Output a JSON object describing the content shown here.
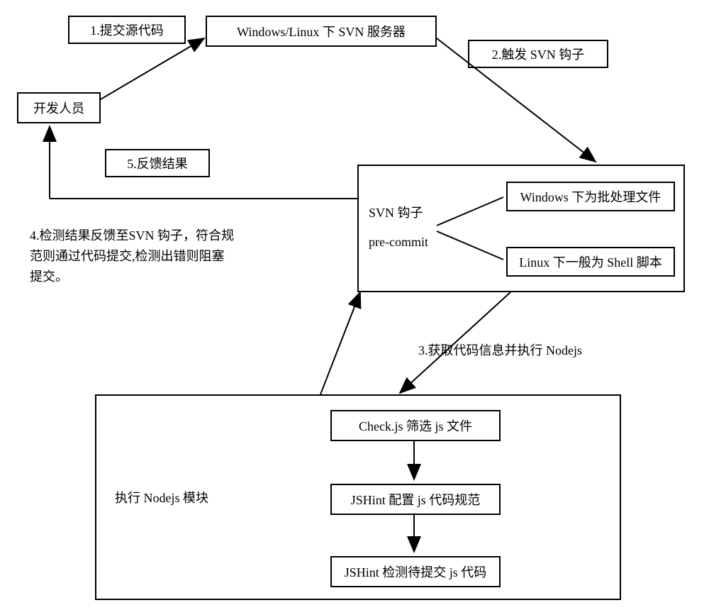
{
  "nodes": {
    "developer": "开发人员",
    "svn_server": "Windows/Linux 下 SVN 服务器",
    "svn_hook_title1": "SVN 钩子",
    "svn_hook_title2": "pre-commit",
    "hook_windows": "Windows 下为批处理文件",
    "hook_linux": "Linux 下一般为 Shell 脚本",
    "nodejs_title": "执行 Nodejs 模块",
    "check_js": "Check.js 筛选 js 文件",
    "jshint_config": "JSHint 配置 js 代码规范",
    "jshint_check": "JSHint 检测待提交 js 代码"
  },
  "edges": {
    "step1": "1.提交源代码",
    "step2": "2.触发 SVN 钩子",
    "step3": "3.获取代码信息并执行 Nodejs",
    "step4": "4.检测结果反馈至SVN 钩子，符合规范则通过代码提交,检测出错则阻塞提交。",
    "step5": "5.反馈结果"
  }
}
